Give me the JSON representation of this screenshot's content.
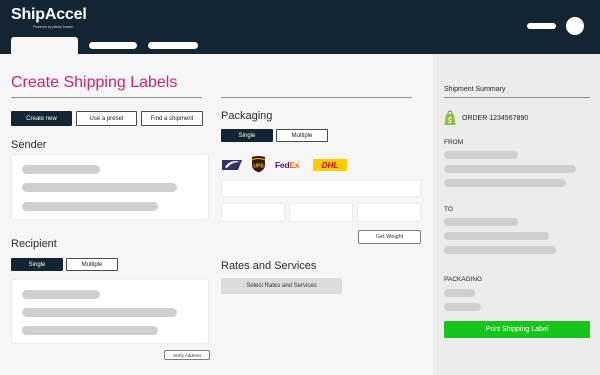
{
  "header": {
    "app_name": "ShipAccel",
    "app_tagline": "Powered by pitney bowes"
  },
  "main": {
    "title": "Create Shipping Labels",
    "actions": {
      "create_new": "Create new",
      "use_preset": "Use a preset",
      "find_shipment": "Find a shipment"
    },
    "sender": {
      "title": "Sender"
    },
    "recipient": {
      "title": "Recipient",
      "toggle": {
        "single": "Single",
        "multiple": "Multiple",
        "selected": "Single"
      },
      "verify_label": "Verify Address"
    },
    "packaging": {
      "title": "Packaging",
      "toggle": {
        "single": "Single",
        "multiple": "Multiple",
        "selected": "Single"
      },
      "carriers": [
        "usps-logo",
        "ups-logo",
        "fedex-logo",
        "dhl-logo"
      ],
      "carrier_text": {
        "ups": "UPS",
        "fedex_fe": "Fed",
        "fedex_ex": "Ex",
        "dhl": "DHL"
      },
      "get_weight_label": "Get Weight"
    },
    "rates": {
      "title": "Rates and Services",
      "select_label": "Select Rates and Services"
    }
  },
  "summary": {
    "title": "Shipment Summary",
    "order": "ORDER 1234567890",
    "from_label": "FROM",
    "to_label": "TO",
    "packaging_label": "PACKAGING",
    "print_label": "Print Shipping Label"
  },
  "colors": {
    "header_bg": "#132433",
    "title_accent": "#c8237c",
    "primary_dark": "#132433",
    "print_green": "#18c41c",
    "skeleton": "#cfcfcf"
  }
}
